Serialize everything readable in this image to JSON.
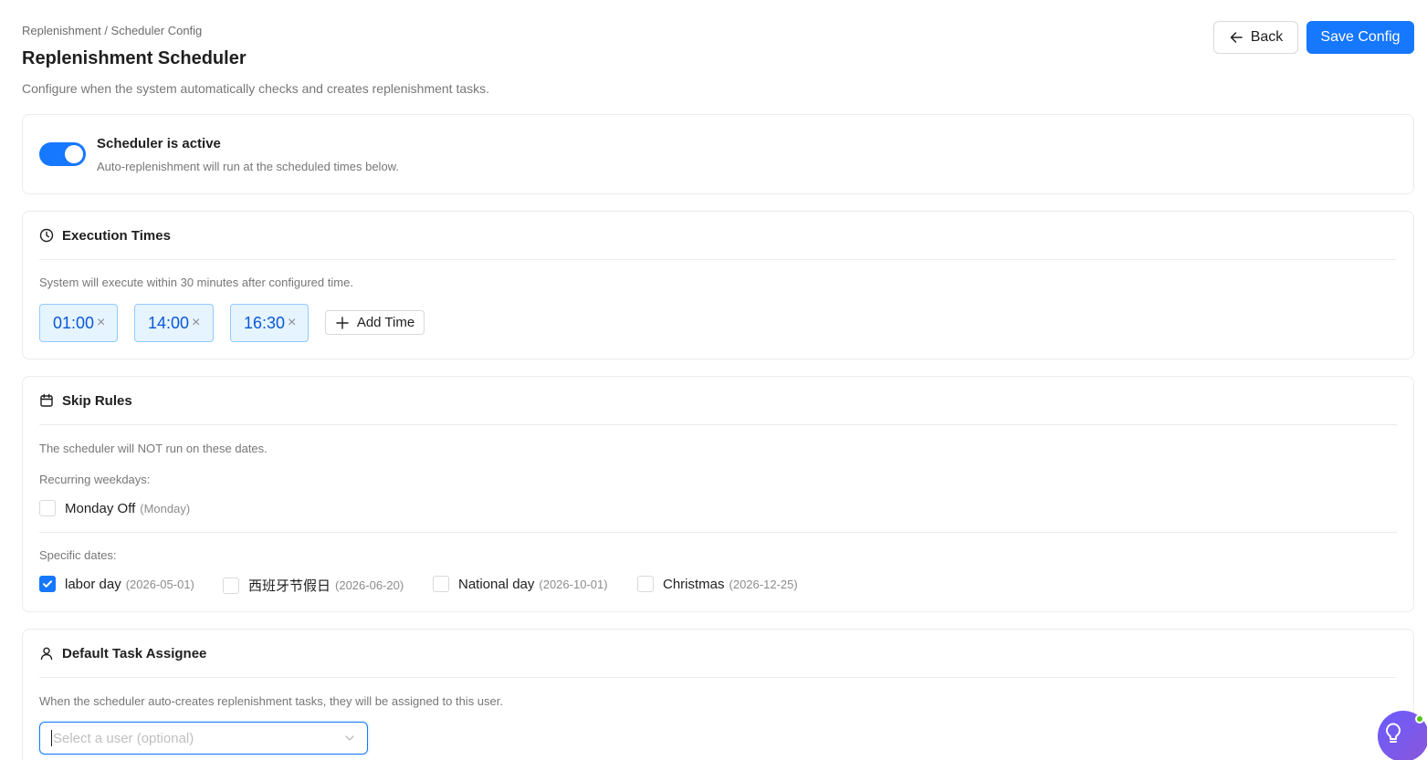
{
  "breadcrumb": "Replenishment / Scheduler Config",
  "title": "Replenishment Scheduler",
  "description": "Configure when the system automatically checks and creates replenishment tasks.",
  "header_buttons": {
    "back": "Back",
    "save": "Save Config"
  },
  "scheduler": {
    "active": true,
    "title": "Scheduler is active",
    "description": "Auto-replenishment will run at the scheduled times below."
  },
  "execution": {
    "title": "Execution Times",
    "description": "System will execute within 30 minutes after configured time.",
    "times": [
      "01:00",
      "14:00",
      "16:30"
    ],
    "add_label": "Add Time",
    "remove_glyph": "×"
  },
  "skip": {
    "title": "Skip Rules",
    "description": "The scheduler will NOT run on these dates.",
    "weekdays_label": "Recurring weekdays:",
    "weekdays": [
      {
        "label": "Monday Off",
        "hint": "(Monday)",
        "checked": false
      }
    ],
    "dates_label": "Specific dates:",
    "dates": [
      {
        "label": "labor day",
        "hint": "(2026-05-01)",
        "checked": true
      },
      {
        "label": "西班牙节假日",
        "hint": "(2026-06-20)",
        "checked": false
      },
      {
        "label": "National day",
        "hint": "(2026-10-01)",
        "checked": false
      },
      {
        "label": "Christmas",
        "hint": "(2026-12-25)",
        "checked": false
      }
    ]
  },
  "assignee": {
    "title": "Default Task Assignee",
    "description": "When the scheduler auto-creates replenishment tasks, they will be assigned to this user.",
    "placeholder": "Select a user (optional)"
  },
  "colors": {
    "primary": "#1677ff",
    "tag_bg": "#e6f4ff",
    "tag_border": "#91caff",
    "fab": "#7b5cf0",
    "status_dot": "#52c41a"
  },
  "icons": {
    "back": "arrow-left-icon",
    "clock": "clock-icon",
    "calendar": "calendar-icon",
    "user": "user-icon",
    "plus": "plus-icon",
    "chevron": "chevron-down-icon",
    "check": "check-icon",
    "help": "lightbulb-icon"
  }
}
